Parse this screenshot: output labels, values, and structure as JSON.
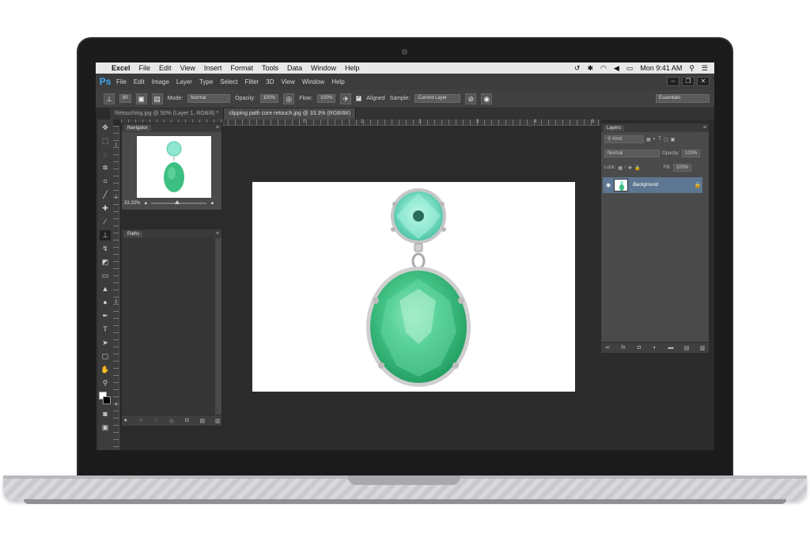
{
  "mac_menu": {
    "apple": "",
    "items": [
      "Excel",
      "File",
      "Edit",
      "View",
      "Insert",
      "Format",
      "Tools",
      "Data",
      "Window",
      "Help"
    ],
    "clock": "Mon 9:41 AM"
  },
  "ps_menu": {
    "logo": "Ps",
    "items": [
      "File",
      "Edit",
      "Image",
      "Layer",
      "Type",
      "Select",
      "Filter",
      "3D",
      "View",
      "Window",
      "Help"
    ]
  },
  "options": {
    "brush_size": "80",
    "mode_label": "Mode:",
    "mode_value": "Normal",
    "opacity_label": "Opacity:",
    "opacity_value": "100%",
    "flow_label": "Flow:",
    "flow_value": "100%",
    "aligned_label": "Aligned",
    "sample_label": "Sample:",
    "sample_value": "Current Layer",
    "workspace": "Essentials"
  },
  "tabs": [
    "Retouching.jpg @ 50% (Layer 1, RGB/8) *",
    "clipping path core retouch.jpg @ 33.3% (RGB/8#)"
  ],
  "ruler_h": [
    "0",
    "1",
    "2",
    "3",
    "4",
    "5",
    "6"
  ],
  "ruler_v": [
    "1",
    "2",
    "3",
    "4"
  ],
  "navigator": {
    "title": "Navigator",
    "zoom": "33.33%"
  },
  "paths": {
    "title": "Paths"
  },
  "layers": {
    "title": "Layers",
    "kind": "Kind",
    "blend": "Normal",
    "opacity_label": "Opacity:",
    "opacity_value": "100%",
    "lock_label": "Lock:",
    "fill_label": "Fill:",
    "fill_value": "100%",
    "layer_name": "Background"
  },
  "colors": {
    "gem_light": "#7fe3cd",
    "gem_body": "#3bbd7f",
    "selected_layer": "#5d7691",
    "ps_blue": "#3fa9f5"
  }
}
